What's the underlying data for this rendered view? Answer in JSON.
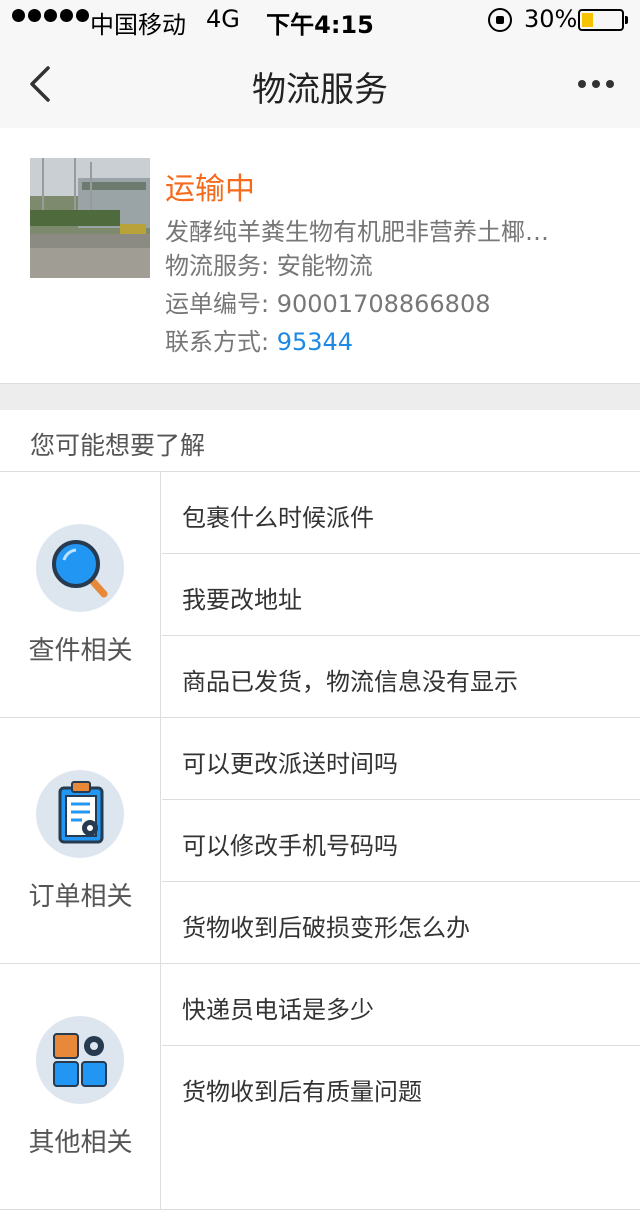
{
  "status_bar": {
    "carrier": "中国移动",
    "network": "4G",
    "time": "下午4:15",
    "battery_text": "30%",
    "battery_level": 0.3
  },
  "nav": {
    "title": "物流服务",
    "back_icon": "chevron-left-icon",
    "more_icon": "more-dots-icon"
  },
  "shipment": {
    "status": "运输中",
    "product": "发酵纯羊粪生物有机肥非营养土椰…",
    "carrier_label": "物流服务: ",
    "carrier_value": "安能物流",
    "waybill_label": "运单编号: ",
    "waybill_value": "90001708866808",
    "contact_label": "联系方式: ",
    "contact_value": "95344",
    "colors": {
      "status": "#f56a1c",
      "link": "#1e88e5"
    }
  },
  "faq": {
    "header": "您可能想要了解",
    "groups": [
      {
        "label": "查件相关",
        "icon": "magnifier-icon",
        "items": [
          "包裹什么时候派件",
          "我要改地址",
          "商品已发货，物流信息没有显示"
        ]
      },
      {
        "label": "订单相关",
        "icon": "clipboard-gear-icon",
        "items": [
          "可以更改派送时间吗",
          "可以修改手机号码吗",
          "货物收到后破损变形怎么办"
        ]
      },
      {
        "label": "其他相关",
        "icon": "apps-gear-icon",
        "items": [
          "快递员电话是多少",
          "货物收到后有质量问题"
        ]
      }
    ]
  }
}
